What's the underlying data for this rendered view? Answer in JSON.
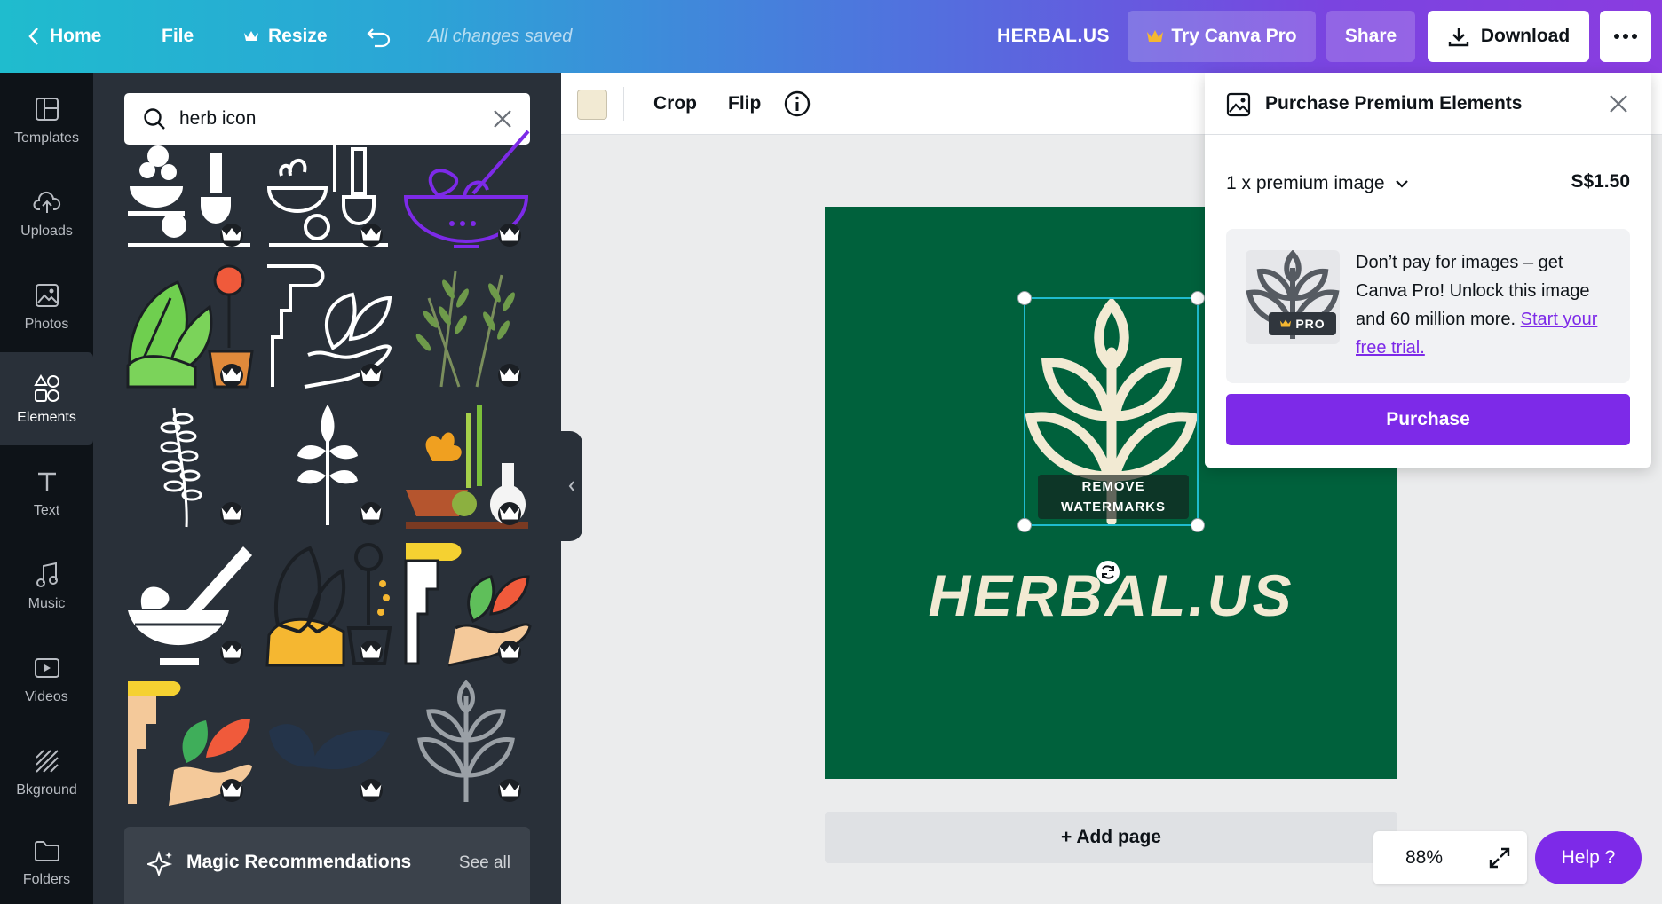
{
  "topbar": {
    "home": "Home",
    "file": "File",
    "resize": "Resize",
    "saved_status": "All changes saved",
    "document_title": "HERBAL.US",
    "try_pro": "Try Canva Pro",
    "share": "Share",
    "download": "Download"
  },
  "rail": {
    "items": [
      {
        "label": "Templates",
        "icon": "templates-icon"
      },
      {
        "label": "Uploads",
        "icon": "upload-icon"
      },
      {
        "label": "Photos",
        "icon": "photo-icon"
      },
      {
        "label": "Elements",
        "icon": "elements-icon"
      },
      {
        "label": "Text",
        "icon": "text-icon"
      },
      {
        "label": "Music",
        "icon": "music-icon"
      },
      {
        "label": "Videos",
        "icon": "video-icon"
      },
      {
        "label": "Bkground",
        "icon": "background-icon"
      },
      {
        "label": "Folders",
        "icon": "folder-icon"
      }
    ],
    "active": "Elements"
  },
  "search": {
    "value": "herb icon"
  },
  "magic": {
    "title": "Magic Recommendations",
    "see_all": "See all"
  },
  "context_toolbar": {
    "swatch_color": "#f2ead3",
    "crop": "Crop",
    "flip": "Flip"
  },
  "design": {
    "title": "HERBAL.US",
    "background": "#00613c",
    "watermark_line1": "REMOVE",
    "watermark_line2": "WATERMARKS"
  },
  "add_page": "+ Add page",
  "zoom": "88%",
  "help": "Help  ?",
  "purchase_popover": {
    "title": "Purchase Premium Elements",
    "quantity": "1 x premium image",
    "price": "S$1.50",
    "promo_text": "Don’t pay for images – get Canva Pro! Unlock this image and 60 million more.",
    "promo_link": "Start your free trial.",
    "badge": "PRO",
    "purchase_button": "Purchase"
  }
}
